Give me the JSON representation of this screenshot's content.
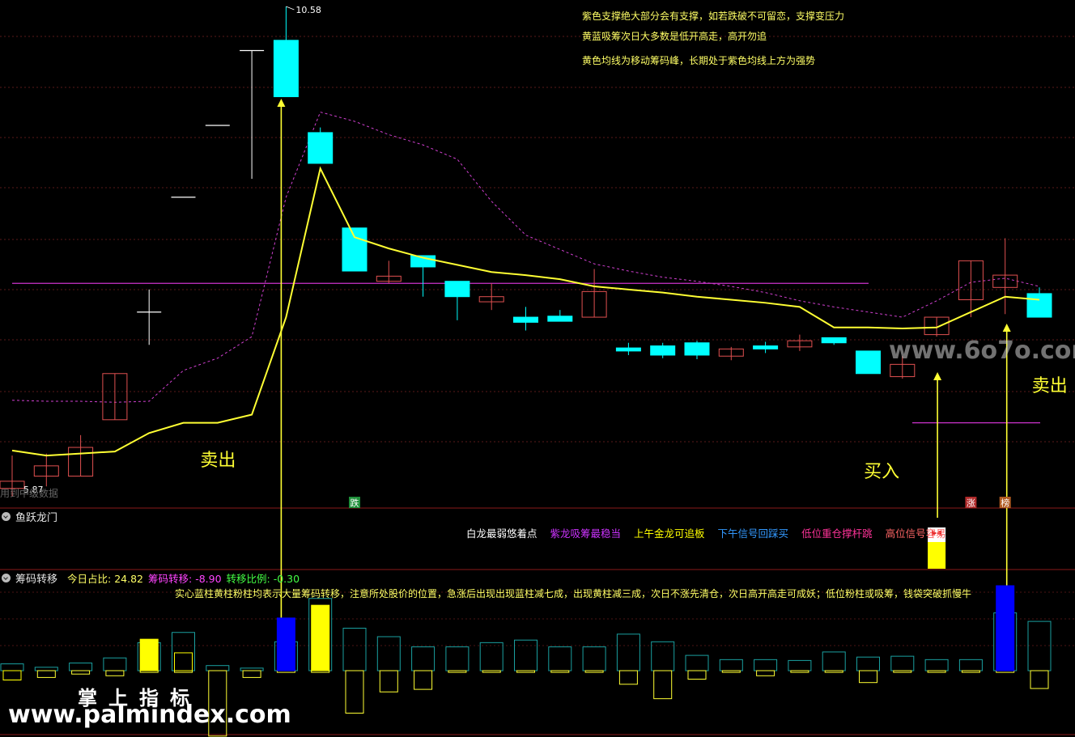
{
  "chart_data": {
    "type": "candlestick",
    "price_labels": {
      "high": "10.58",
      "low": "5.87"
    },
    "candles": [
      {
        "o": 5.95,
        "c": 5.88,
        "h": 6.2,
        "l": 5.8,
        "color": "red"
      },
      {
        "o": 6.1,
        "c": 6.0,
        "h": 6.22,
        "l": 5.9,
        "color": "red"
      },
      {
        "o": 6.0,
        "c": 6.28,
        "h": 6.4,
        "l": 6.0,
        "color": "red"
      },
      {
        "o": 6.55,
        "c": 7.0,
        "h": 7.0,
        "l": 6.55,
        "color": "red"
      },
      {
        "o": 7.6,
        "c": 7.6,
        "h": 7.82,
        "l": 7.28,
        "color": "white"
      },
      {
        "o": 8.72,
        "c": 8.72,
        "h": 8.72,
        "l": 8.72,
        "color": "white"
      },
      {
        "o": 9.42,
        "c": 9.42,
        "h": 9.42,
        "l": 9.42,
        "color": "white"
      },
      {
        "o": 10.15,
        "c": 10.15,
        "h": 10.15,
        "l": 8.9,
        "color": "white"
      },
      {
        "o": 9.7,
        "c": 10.25,
        "h": 10.58,
        "l": 9.7,
        "color": "cyan"
      },
      {
        "o": 9.35,
        "c": 9.05,
        "h": 9.4,
        "l": 9.05,
        "color": "cyan"
      },
      {
        "o": 8.42,
        "c": 8.0,
        "h": 8.42,
        "l": 8.0,
        "color": "cyan"
      },
      {
        "o": 7.95,
        "c": 7.9,
        "h": 8.1,
        "l": 7.88,
        "color": "red"
      },
      {
        "o": 8.15,
        "c": 8.04,
        "h": 8.15,
        "l": 7.75,
        "color": "cyan"
      },
      {
        "o": 7.9,
        "c": 7.75,
        "h": 7.9,
        "l": 7.52,
        "color": "cyan"
      },
      {
        "o": 7.75,
        "c": 7.7,
        "h": 7.88,
        "l": 7.62,
        "color": "red"
      },
      {
        "o": 7.55,
        "c": 7.5,
        "h": 7.65,
        "l": 7.42,
        "color": "cyan"
      },
      {
        "o": 7.56,
        "c": 7.51,
        "h": 7.62,
        "l": 7.51,
        "color": "cyan"
      },
      {
        "o": 7.8,
        "c": 7.55,
        "h": 8.02,
        "l": 7.55,
        "color": "red"
      },
      {
        "o": 7.25,
        "c": 7.22,
        "h": 7.3,
        "l": 7.18,
        "color": "cyan"
      },
      {
        "o": 7.27,
        "c": 7.18,
        "h": 7.3,
        "l": 7.15,
        "color": "cyan"
      },
      {
        "o": 7.3,
        "c": 7.18,
        "h": 7.32,
        "l": 7.14,
        "color": "cyan"
      },
      {
        "o": 7.24,
        "c": 7.17,
        "h": 7.26,
        "l": 7.13,
        "color": "red"
      },
      {
        "o": 7.27,
        "c": 7.24,
        "h": 7.31,
        "l": 7.2,
        "color": "cyan"
      },
      {
        "o": 7.32,
        "c": 7.26,
        "h": 7.38,
        "l": 7.22,
        "color": "red"
      },
      {
        "o": 7.35,
        "c": 7.3,
        "h": 7.35,
        "l": 7.28,
        "color": "cyan"
      },
      {
        "o": 7.22,
        "c": 7.0,
        "h": 7.22,
        "l": 7.0,
        "color": "cyan"
      },
      {
        "o": 7.09,
        "c": 6.97,
        "h": 7.17,
        "l": 6.95,
        "color": "red"
      },
      {
        "o": 7.55,
        "c": 7.38,
        "h": 7.55,
        "l": 7.36,
        "color": "red"
      },
      {
        "o": 8.1,
        "c": 7.72,
        "h": 8.1,
        "l": 7.55,
        "color": "red"
      },
      {
        "o": 7.96,
        "c": 7.84,
        "h": 8.32,
        "l": 7.58,
        "color": "red"
      },
      {
        "o": 7.78,
        "c": 7.55,
        "h": 7.84,
        "l": 7.55,
        "color": "cyan"
      }
    ],
    "ma_yellow": [
      6.25,
      6.2,
      6.22,
      6.24,
      6.42,
      6.52,
      6.52,
      6.6,
      7.55,
      9.0,
      8.33,
      8.22,
      8.13,
      8.06,
      7.99,
      7.96,
      7.92,
      7.85,
      7.82,
      7.79,
      7.75,
      7.72,
      7.69,
      7.65,
      7.45,
      7.45,
      7.44,
      7.45,
      7.6,
      7.75,
      7.72
    ],
    "ma_purple": [
      6.74,
      6.73,
      6.73,
      6.72,
      6.73,
      7.03,
      7.15,
      7.36,
      8.72,
      9.55,
      9.46,
      9.33,
      9.23,
      9.09,
      8.68,
      8.35,
      8.21,
      8.07,
      8.0,
      7.94,
      7.9,
      7.85,
      7.79,
      7.71,
      7.65,
      7.6,
      7.55,
      7.71,
      7.89,
      7.93,
      7.85
    ],
    "hline_main": 7.88,
    "hline_short": 6.52,
    "annotations": [
      {
        "text": "卖出",
        "at": 8
      },
      {
        "text": "买入",
        "at": 27
      },
      {
        "text": "卖出",
        "at": 29
      }
    ],
    "markers": [
      {
        "text": "跌",
        "at": 10,
        "bg": "#1f8f3a"
      },
      {
        "text": "涨",
        "at": 28,
        "bg": "#b02a2a"
      },
      {
        "text": "榜",
        "at": 29,
        "bg": "#b05a20"
      }
    ],
    "signal_bar_at": 27,
    "flow_upper": [
      0.8,
      0.4,
      0.9,
      1.5,
      3.3,
      4.5,
      0.6,
      0.3,
      3.4,
      8.5,
      5.0,
      4.0,
      2.8,
      2.8,
      3.3,
      3.6,
      2.8,
      2.8,
      4.3,
      3.4,
      1.8,
      1.3,
      1.3,
      1.2,
      2.2,
      1.6,
      1.7,
      1.3,
      1.3,
      6.8,
      5.8
    ],
    "flow_lower": [
      -1.1,
      -0.8,
      -0.4,
      -0.6,
      -0.2,
      -0.2,
      -7.7,
      -0.8,
      -0.2,
      -0.2,
      -5.0,
      -2.5,
      -2.2,
      -0.2,
      -0.2,
      -0.2,
      -0.2,
      -0.2,
      -1.6,
      -3.3,
      -1.0,
      -0.2,
      -0.6,
      -0.2,
      -0.2,
      -1.4,
      -0.2,
      -0.2,
      -0.2,
      -0.2,
      -2.1
    ],
    "flow_fill": [
      {
        "at": 0,
        "v": -1.1,
        "color": "#ffff00",
        "solid": false
      },
      {
        "at": 4,
        "v": 3.7,
        "color": "#ffff00",
        "solid": true
      },
      {
        "at": 5,
        "v": 2.1,
        "color": "#ffff00",
        "solid": false
      },
      {
        "at": 8,
        "v": 6.2,
        "color": "#0000ff",
        "solid": true
      },
      {
        "at": 9,
        "v": 7.7,
        "color": "#ffff00",
        "solid": true
      },
      {
        "at": 29,
        "v": 10.0,
        "color": "#0000ff",
        "solid": true
      }
    ]
  },
  "notes": [
    "紫色支撑绝大部分会有支撑，如若跌破不可留恋，支撑变压力",
    "黄蓝吸筹次日大多数是低开高走，高开勿追",
    "黄色均线为移动筹码峰，长期处于紫色均线上方为强势"
  ],
  "watermark_top": "www.6o7o.com",
  "faded_text": "用到中级数据",
  "panel1": {
    "title": "鱼跃龙门",
    "labels": [
      {
        "text": "白龙最弱悠着点",
        "color": "#ffffff"
      },
      {
        "text": "紫龙吸筹最稳当",
        "color": "#cc33ff"
      },
      {
        "text": "上午金龙可追板",
        "color": "#ffff00"
      },
      {
        "text": "下午信号回踩买",
        "color": "#3399ff"
      },
      {
        "text": "低位重仓撑杆跳",
        "color": "#ff3399"
      },
      {
        "text": "高位信号容易",
        "color": "#ff6666"
      }
    ]
  },
  "panel2": {
    "title": "筹码转移",
    "stats": [
      {
        "label": "今日占比: ",
        "value": "24.82",
        "color": "#ffff66"
      },
      {
        "label": "筹码转移: ",
        "value": "-8.90",
        "color": "#ff44ff"
      },
      {
        "label": "转移比例: ",
        "value": "-0.30",
        "color": "#44ff44"
      }
    ],
    "desc": "实心蓝柱黄柱粉柱均表示大量筹码转移，注意所处股价的位置，急涨后出现出现蓝柱减七成，出现黄柱减三成，次日不涨先清仓，次日高开高走可成妖；低位粉柱或吸筹，钱袋突破抓慢牛"
  },
  "brand": {
    "cn": "掌上指标",
    "url": "www.palmindex.com"
  }
}
